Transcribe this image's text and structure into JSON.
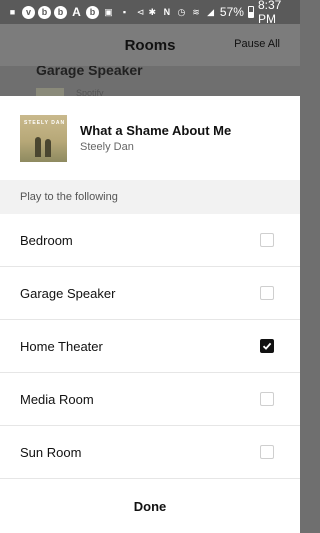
{
  "status_bar": {
    "battery": "57%",
    "time": "8:37 PM",
    "left_icons": [
      "camera-icon",
      "v-icon",
      "b-icon",
      "b-icon",
      "a-icon",
      "b-icon",
      "bag-icon",
      "lock-icon",
      "cast-icon"
    ],
    "right_icons": [
      "bluetooth-icon",
      "nfc-icon",
      "alarm-icon",
      "wifi-icon",
      "signal-icon",
      "battery-icon"
    ]
  },
  "header": {
    "title": "Rooms",
    "pause_all": "Pause All"
  },
  "background": {
    "room_title": "Garage Speaker",
    "sub": "Spotify"
  },
  "now_playing": {
    "album_band_text": "STEELY DAN",
    "title": "What a Shame About Me",
    "artist": "Steely Dan"
  },
  "section_header": "Play to the following",
  "rooms": [
    {
      "name": "Bedroom",
      "checked": false
    },
    {
      "name": "Garage Speaker",
      "checked": false
    },
    {
      "name": "Home Theater",
      "checked": true
    },
    {
      "name": "Media Room",
      "checked": false
    },
    {
      "name": "Sun Room",
      "checked": false
    }
  ],
  "done_label": "Done",
  "colors": {
    "overlay_bg": "#6f6f6f",
    "sheet_bg": "#ffffff",
    "checkbox_checked": "#111111"
  }
}
